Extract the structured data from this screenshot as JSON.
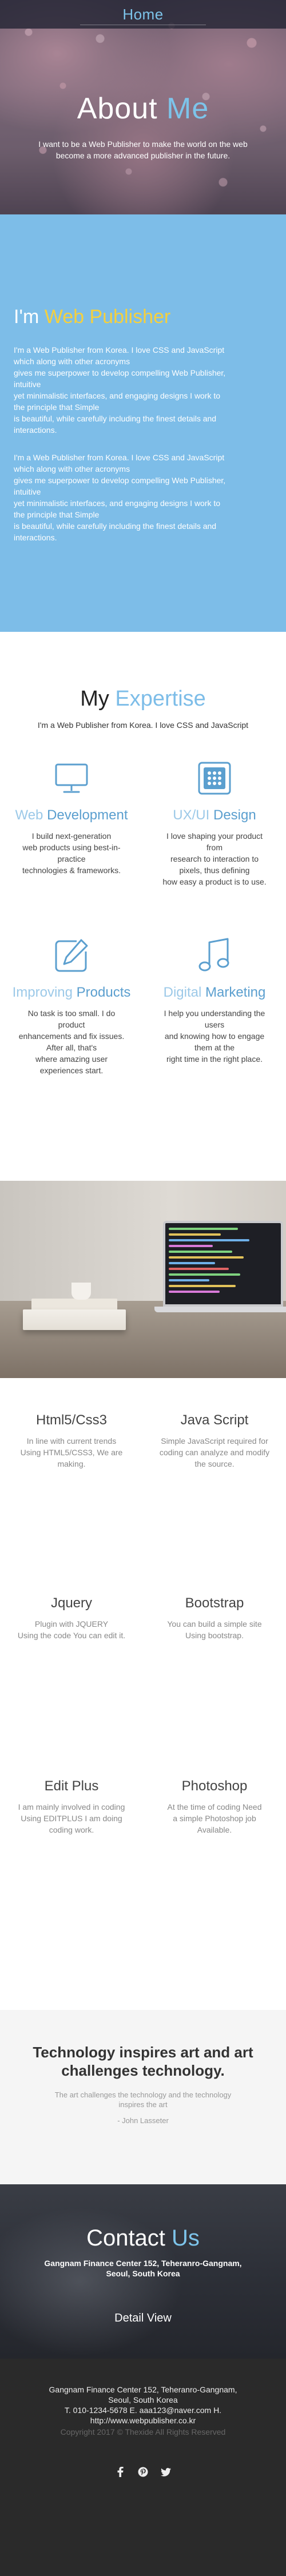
{
  "navbar": {
    "brand": "Home"
  },
  "hero": {
    "title_part1": "About ",
    "title_part2": "Me",
    "desc_line1": "I want to be a Web Publisher to make the world on the web",
    "desc_line2": "become a more advanced publisher in the future."
  },
  "publisher": {
    "title_part1": "I'm ",
    "title_part2": "Web Publisher",
    "para1_lines": [
      "I'm a Web Publisher from Korea. I love CSS and JavaScript",
      "which along with other acronyms",
      "gives me superpower to develop compelling Web Publisher,",
      "intuitive",
      "yet minimalistic interfaces, and engaging designs I work to",
      "the principle that Simple",
      "is beautiful, while carefully including the finest details and",
      "interactions."
    ],
    "para2_lines": [
      "I'm a Web Publisher from Korea. I love CSS and JavaScript",
      "which along with other acronyms",
      "gives me superpower to develop compelling Web Publisher,",
      "intuitive",
      "yet minimalistic interfaces, and engaging designs I work to",
      "the principle that Simple",
      "is beautiful, while carefully including the finest details and",
      "interactions."
    ]
  },
  "expertise": {
    "title_part1": "My ",
    "title_part2": "Expertise",
    "subtitle": "I'm a Web Publisher from Korea. I love CSS and JavaScript",
    "items": [
      {
        "icon": "monitor-icon",
        "name_part1": "Web ",
        "name_part2": "Development",
        "desc_lines": [
          "I build next-generation",
          "web products using best-in-",
          "practice",
          "technologies & frameworks."
        ]
      },
      {
        "icon": "grid-window-icon",
        "name_part1": "UX/UI ",
        "name_part2": "Design",
        "desc_lines": [
          "I love shaping your product",
          "from",
          "research to interaction to",
          "pixels, thus defining",
          "how easy a product is to use."
        ]
      },
      {
        "icon": "edit-icon",
        "name_part1": "Improving ",
        "name_part2": "Products",
        "desc_lines": [
          "No task is too small. I do",
          "product",
          "enhancements and fix issues.",
          "After all, that's",
          "where amazing user",
          "experiences start."
        ]
      },
      {
        "icon": "music-note-icon",
        "name_part1": "Digital ",
        "name_part2": "Marketing",
        "desc_lines": [
          "I help you understanding the",
          "users",
          "and knowing how to engage",
          "them at the",
          "right time in the right place."
        ]
      }
    ]
  },
  "skills": {
    "items": [
      {
        "name": "Html5/Css3",
        "desc_lines": [
          "In line with current trends",
          "Using HTML5/CSS3, We are",
          "making."
        ]
      },
      {
        "name": "Java Script",
        "desc_lines": [
          "Simple JavaScript required for",
          "coding can analyze and modify",
          "the source."
        ]
      },
      {
        "name": "Jquery",
        "desc_lines": [
          "Plugin with JQUERY",
          "Using the code You can edit it."
        ]
      },
      {
        "name": "Bootstrap",
        "desc_lines": [
          "You can build a simple site",
          "Using bootstrap."
        ]
      },
      {
        "name": "Edit Plus",
        "desc_lines": [
          "I am mainly involved in coding",
          "Using EDITPLUS I am doing",
          "coding work."
        ]
      },
      {
        "name": "Photoshop",
        "desc_lines": [
          "At the time of coding Need",
          "a simple Photoshop job",
          "Available."
        ]
      }
    ]
  },
  "quote": {
    "title_line1": "Technology inspires art and art",
    "title_line2": "challenges technology.",
    "text_line1": "The art challenges the technology and the technology",
    "text_line2": "inspires the art",
    "author": "- John Lasseter"
  },
  "contact": {
    "title_part1": "Contact ",
    "title_part2": "Us",
    "address_line1": "Gangnam Finance Center 152, Teheranro-Gangnam,",
    "address_line2": "Seoul, South Korea",
    "button": "Detail View"
  },
  "footer": {
    "address_line1": "Gangnam Finance Center 152, Teheranro-Gangnam,",
    "address_line2": "Seoul, South Korea",
    "phone_line": "T. 010-1234-5678      E. aaa123@naver.com      H.",
    "url": "http://www.webpublisher.co.kr",
    "copyright": "Copyright 2017 © Thexide All Rights Reserved",
    "social": [
      "facebook-icon",
      "pinterest-icon",
      "twitter-icon"
    ]
  },
  "colors": {
    "accent": "#7dc4ea",
    "publisher_bg": "#7dbde8",
    "highlight": "#f4d03f",
    "footer_bg": "#2a2a2a"
  }
}
